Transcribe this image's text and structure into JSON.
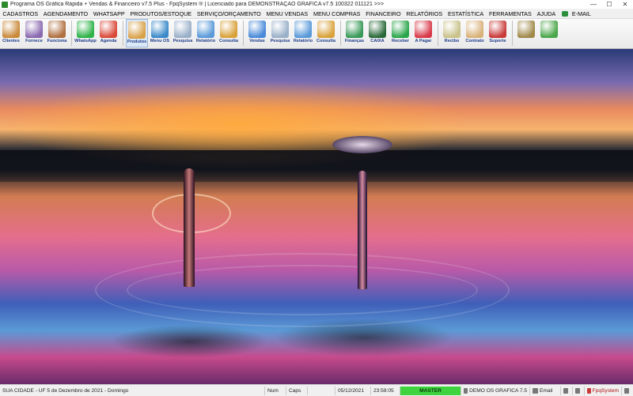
{
  "window": {
    "title": "Programa OS Gráfica Rápida + Vendas & Financeiro v7.5 Plus - FpqSystem ® | Licenciado para  DEMONSTRAÇÃO GRAFICA v7.5 100322 011121 >>>",
    "minimize": "—",
    "maximize": "☐",
    "close": "✕"
  },
  "menu": [
    "CADASTROS",
    "AGENDAMENTO",
    "WHATSAPP",
    "PRODUTOS/ESTOQUE",
    "SERVIÇO/ORÇAMENTO",
    "MENU VENDAS",
    "MENU COMPRAS",
    "FINANCEIRO",
    "RELATÓRIOS",
    "ESTATÍSTICA",
    "FERRAMENTAS",
    "AJUDA",
    "E-MAIL"
  ],
  "toolbar": [
    {
      "label": "Clientes",
      "icon": "clients-icon",
      "color": "#c98a3a"
    },
    {
      "label": "Fornece",
      "icon": "supplier-icon",
      "color": "#8a6ab0"
    },
    {
      "label": "Funciona",
      "icon": "employees-icon",
      "color": "#b07040"
    },
    {
      "label": "WhatsApp",
      "icon": "whatsapp-icon",
      "color": "#2fb34a"
    },
    {
      "label": "Agenda",
      "icon": "calendar-icon",
      "color": "#d94a3a"
    },
    {
      "label": "Produtos",
      "icon": "products-icon",
      "color": "#d9a24a"
    },
    {
      "label": "Menu OS",
      "icon": "service-order-icon",
      "color": "#3a8ac9"
    },
    {
      "label": "Pesquisa",
      "icon": "search-document-icon",
      "color": "#9ab0c9"
    },
    {
      "label": "Relatório",
      "icon": "report-icon",
      "color": "#5a9ad9"
    },
    {
      "label": "Consulta",
      "icon": "folder-icon",
      "color": "#d9a23a"
    },
    {
      "label": "Vendas",
      "icon": "sales-icon",
      "color": "#4a8ad9"
    },
    {
      "label": "Pesquisa",
      "icon": "search-document-icon",
      "color": "#9ab0c9"
    },
    {
      "label": "Relatório",
      "icon": "report-icon",
      "color": "#5a9ad9"
    },
    {
      "label": "Consulta",
      "icon": "folder-icon",
      "color": "#d9a23a"
    },
    {
      "label": "Finanças",
      "icon": "finance-icon",
      "color": "#3a9a5a"
    },
    {
      "label": "CAIXA",
      "icon": "cash-register-icon",
      "color": "#2a6a3a"
    },
    {
      "label": "Receber",
      "icon": "receive-money-icon",
      "color": "#2aa64a"
    },
    {
      "label": "A Pagar",
      "icon": "pay-money-icon",
      "color": "#d93a4a"
    },
    {
      "label": "Recibo",
      "icon": "receipt-icon",
      "color": "#c9c28a"
    },
    {
      "label": "Contrato",
      "icon": "contract-icon",
      "color": "#d9b27a"
    },
    {
      "label": "Suporte",
      "icon": "support-icon",
      "color": "#c93a3a"
    },
    {
      "label": "",
      "icon": "settings-icon",
      "color": "#a08a4a"
    },
    {
      "label": "",
      "icon": "exit-icon",
      "color": "#4aa64a"
    }
  ],
  "status": {
    "location": "SUA CIDADE - UF  5 de Dezembro de 2021 - Domingo",
    "num": "Num",
    "caps": "Caps",
    "empty": "",
    "date": "05/12/2021",
    "time": "23:58:05",
    "user": "MASTER",
    "company": "DEMO OS GRAFICA 7.5",
    "email": "Email",
    "brand": "FpqSystem"
  }
}
